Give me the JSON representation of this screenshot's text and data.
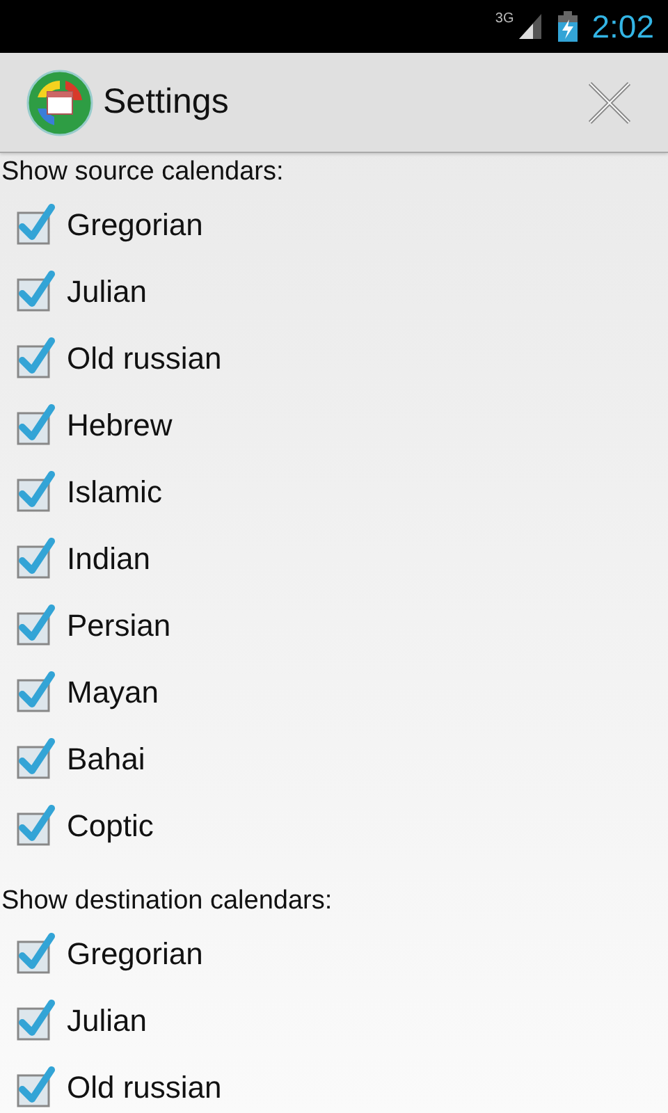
{
  "status_bar": {
    "network": "3G",
    "time": "2:02"
  },
  "action_bar": {
    "title": "Settings"
  },
  "sections": [
    {
      "heading": "Show source calendars:",
      "items": [
        {
          "label": "Gregorian",
          "checked": true
        },
        {
          "label": "Julian",
          "checked": true
        },
        {
          "label": "Old russian",
          "checked": true
        },
        {
          "label": "Hebrew",
          "checked": true
        },
        {
          "label": "Islamic",
          "checked": true
        },
        {
          "label": "Indian",
          "checked": true
        },
        {
          "label": "Persian",
          "checked": true
        },
        {
          "label": "Mayan",
          "checked": true
        },
        {
          "label": "Bahai",
          "checked": true
        },
        {
          "label": "Coptic",
          "checked": true
        }
      ]
    },
    {
      "heading": "Show destination calendars:",
      "items": [
        {
          "label": "Gregorian",
          "checked": true
        },
        {
          "label": "Julian",
          "checked": true
        },
        {
          "label": "Old russian",
          "checked": true
        }
      ]
    }
  ]
}
